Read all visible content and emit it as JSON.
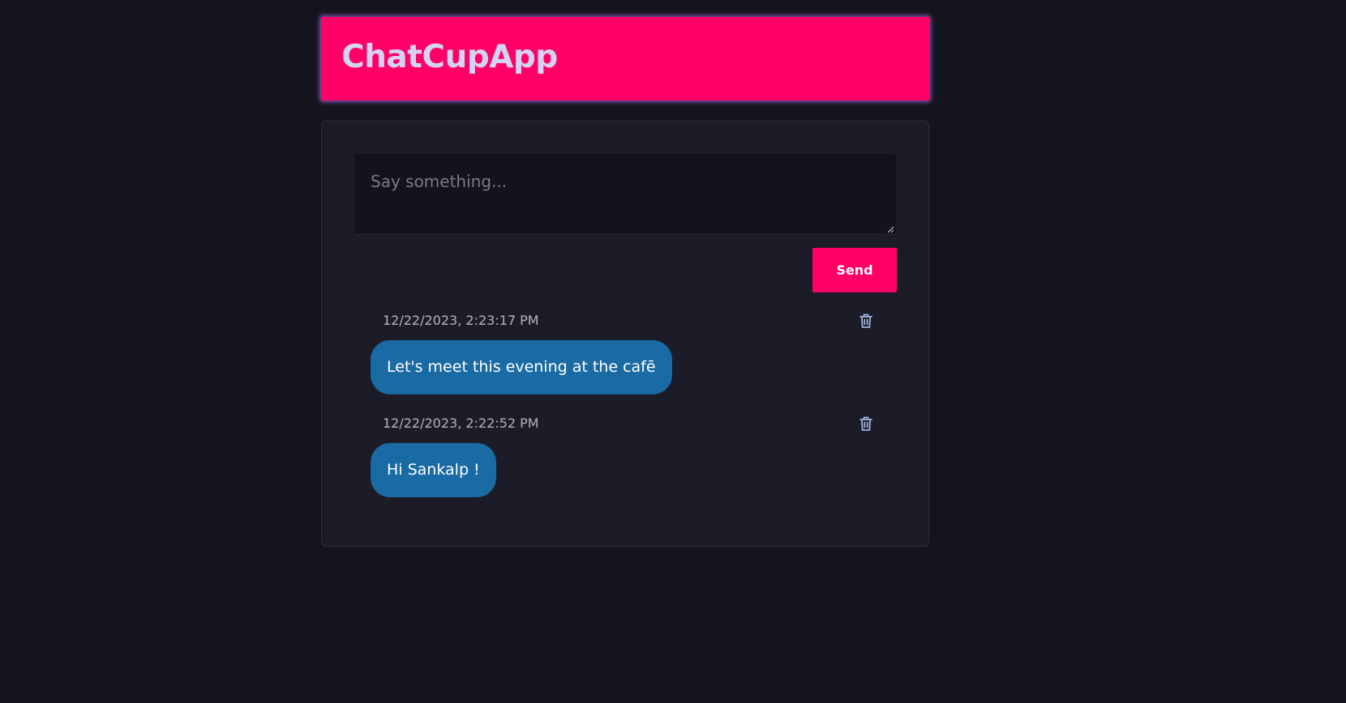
{
  "app": {
    "title": "ChatCupApp"
  },
  "composer": {
    "placeholder": "Say something...",
    "value": "",
    "send_label": "Send"
  },
  "messages": [
    {
      "timestamp": "12/22/2023, 2:23:17 PM",
      "text": "Let's meet this evening at the cafē",
      "delete_icon": "trash-icon"
    },
    {
      "timestamp": "12/22/2023, 2:22:52 PM",
      "text": "Hi Sankalp !",
      "delete_icon": "trash-icon"
    }
  ],
  "colors": {
    "background": "#14141e",
    "header": "#ff0066",
    "header_text": "#d6d3f2",
    "panel": "#1c1c28",
    "input": "#13131c",
    "send_button": "#ff0066",
    "bubble": "#1a6aa3",
    "timestamp": "#b4b4be",
    "icon": "#9fb4e0"
  }
}
